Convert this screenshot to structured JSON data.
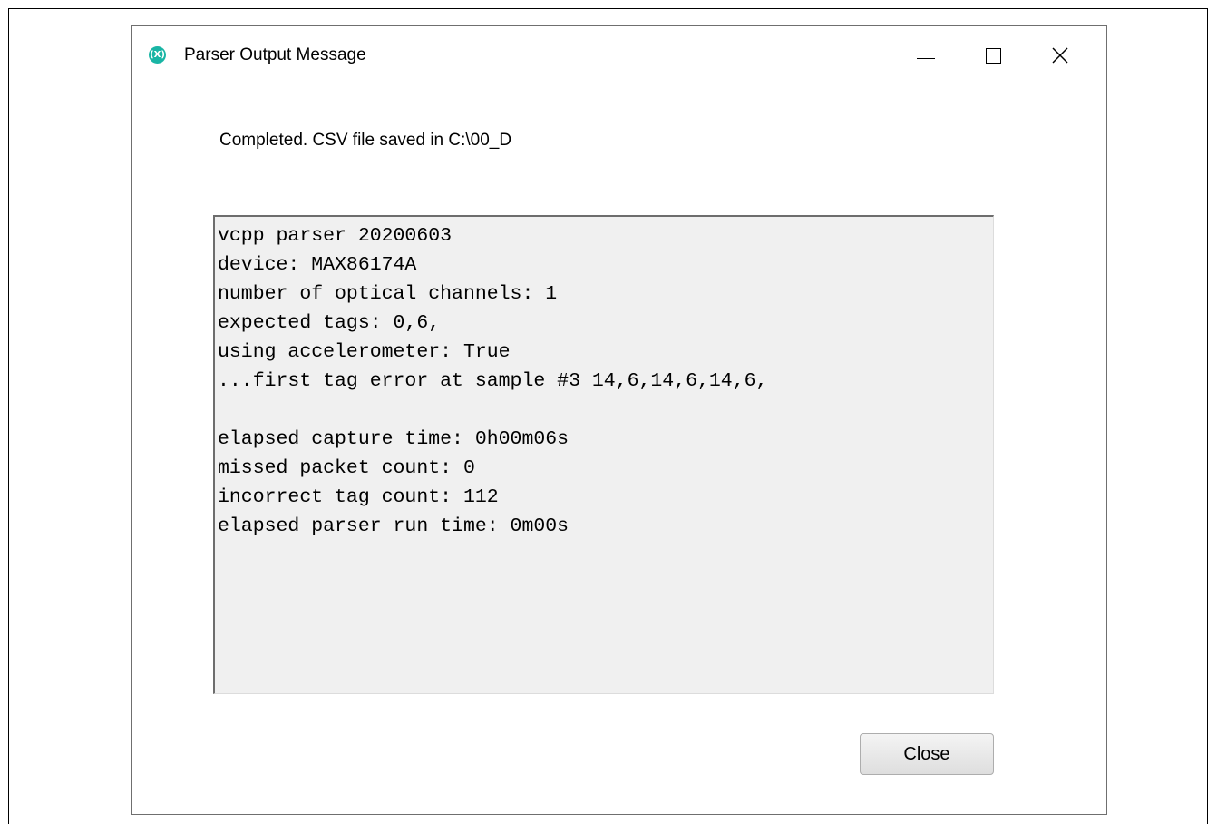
{
  "window": {
    "title": "Parser Output Message",
    "icon_glyph": "(X)",
    "icon_name": "maxim-logo-icon",
    "accent_color": "#19b5a5",
    "controls": {
      "minimize": "minimize-icon",
      "maximize": "maximize-icon",
      "close_glyph": "✕"
    }
  },
  "message": "Completed. CSV file saved in C:\\00_D",
  "output_lines": [
    "vcpp parser 20200603",
    "device: MAX86174A",
    "number of optical channels: 1",
    "expected tags: 0,6,",
    "using accelerometer: True",
    "...first tag error at sample #3 14,6,14,6,14,6,",
    "",
    "elapsed capture time: 0h00m06s",
    "missed packet count: 0",
    "incorrect tag count: 112",
    "elapsed parser run time: 0m00s"
  ],
  "buttons": {
    "close_label": "Close"
  }
}
